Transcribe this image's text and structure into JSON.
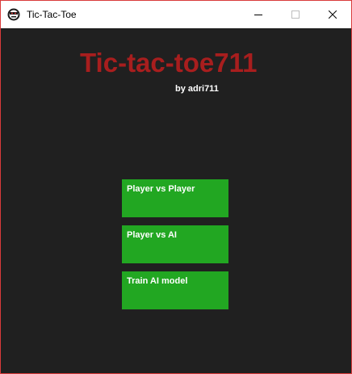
{
  "window": {
    "title": "Tic-Tac-Toe",
    "app_icon": "tic-tac-toe-app-icon",
    "controls": [
      "minimize-icon",
      "maximize-icon",
      "close-icon"
    ],
    "border_color": "#d93b3b"
  },
  "main": {
    "title": "Tic-tac-toe711",
    "byline": "by adri711",
    "background_color": "#202020",
    "title_color": "#a81e1e",
    "button_color": "#22a722"
  },
  "menu": {
    "buttons": [
      {
        "label": "Player vs Player"
      },
      {
        "label": "Player vs AI"
      },
      {
        "label": "Train AI model"
      }
    ]
  }
}
